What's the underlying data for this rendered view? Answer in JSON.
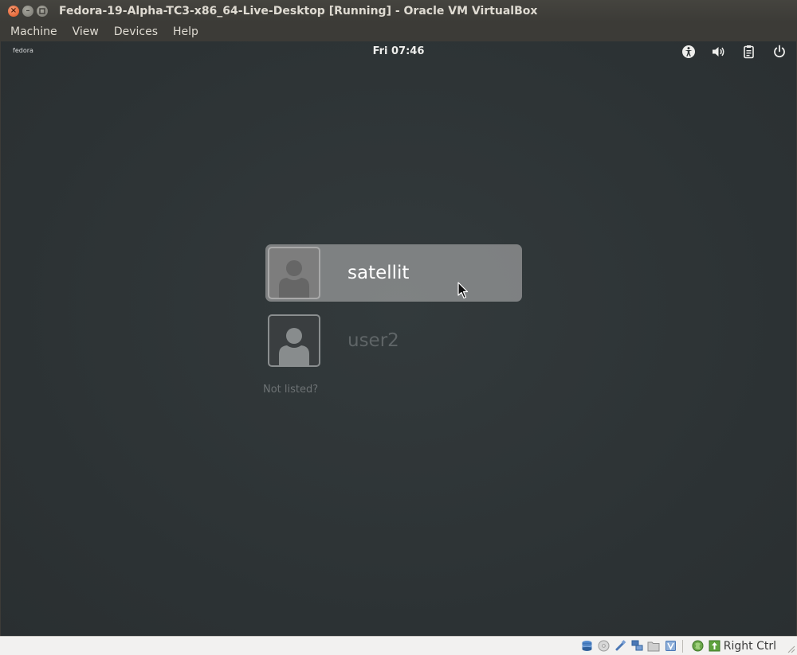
{
  "window": {
    "title": "Fedora-19-Alpha-TC3-x86_64-Live-Desktop [Running] - Oracle VM VirtualBox",
    "buttons": {
      "close": "close-icon",
      "minimize": "minimize-icon",
      "maximize": "maximize-icon"
    }
  },
  "menubar": {
    "items": [
      {
        "label": "Machine"
      },
      {
        "label": "View"
      },
      {
        "label": "Devices"
      },
      {
        "label": "Help"
      }
    ]
  },
  "guest": {
    "logo_text": "fedora",
    "clock": "Fri 07:46",
    "tray": [
      "accessibility-icon",
      "volume-icon",
      "clipboard-icon",
      "power-icon"
    ],
    "users": [
      {
        "name": "satellit",
        "selected": true
      },
      {
        "name": "user2",
        "selected": false
      }
    ],
    "not_listed": "Not listed?"
  },
  "statusbar": {
    "icons": [
      "hard-disk-icon",
      "optical-drive-icon",
      "usb-icon",
      "network-icon",
      "shared-folder-icon",
      "video-capture-icon",
      "virtualization-icon",
      "mouse-integration-icon"
    ],
    "host_key": "Right Ctrl"
  },
  "colors": {
    "guest_background": "#2e3436",
    "host_chrome": "#3c3b37",
    "close_button": "#e0531f",
    "statusbar": "#f2f1f0"
  }
}
